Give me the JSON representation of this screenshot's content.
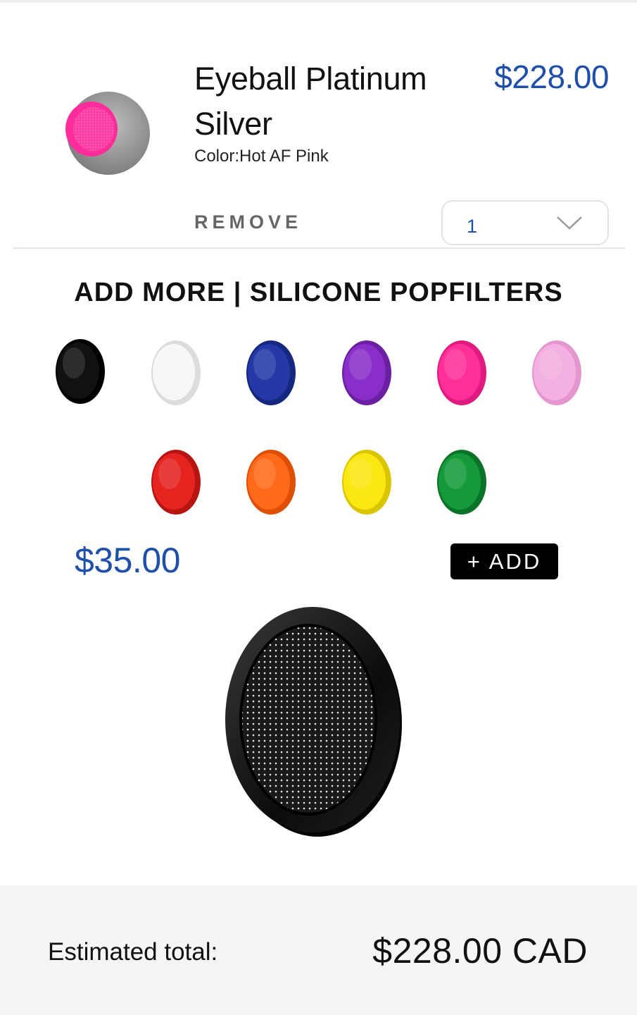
{
  "cart_item": {
    "title": "Eyeball Platinum Silver",
    "color_label": "Color:Hot AF Pink",
    "price": "$228.00",
    "remove_label": "REMOVE",
    "quantity": "1",
    "thumbnail_colors": {
      "body": "#8e8e8e",
      "filter": "#ff2d9b"
    }
  },
  "upsell": {
    "title": "ADD MORE | SILICONE POPFILTERS",
    "swatches": [
      {
        "name": "black",
        "color": "#111111",
        "rim": "#000000"
      },
      {
        "name": "white",
        "color": "#f7f7f7",
        "rim": "#dcdcdc"
      },
      {
        "name": "blue",
        "color": "#2439a6",
        "rim": "#162780"
      },
      {
        "name": "purple",
        "color": "#8a2ec9",
        "rim": "#6b1fa3"
      },
      {
        "name": "pink",
        "color": "#ff2f98",
        "rim": "#e01a7f"
      },
      {
        "name": "light-pink",
        "color": "#f3b0e0",
        "rim": "#e496cf"
      },
      {
        "name": "red",
        "color": "#e52420",
        "rim": "#b81512"
      },
      {
        "name": "orange",
        "color": "#ff6a1a",
        "rim": "#de4f05"
      },
      {
        "name": "yellow",
        "color": "#fbe812",
        "rim": "#d9c500"
      },
      {
        "name": "green",
        "color": "#149a3a",
        "rim": "#0b7328"
      }
    ],
    "price": "$35.00",
    "add_label": "+ ADD"
  },
  "footer": {
    "total_label": "Estimated total:",
    "total_value": "$228.00 CAD"
  }
}
